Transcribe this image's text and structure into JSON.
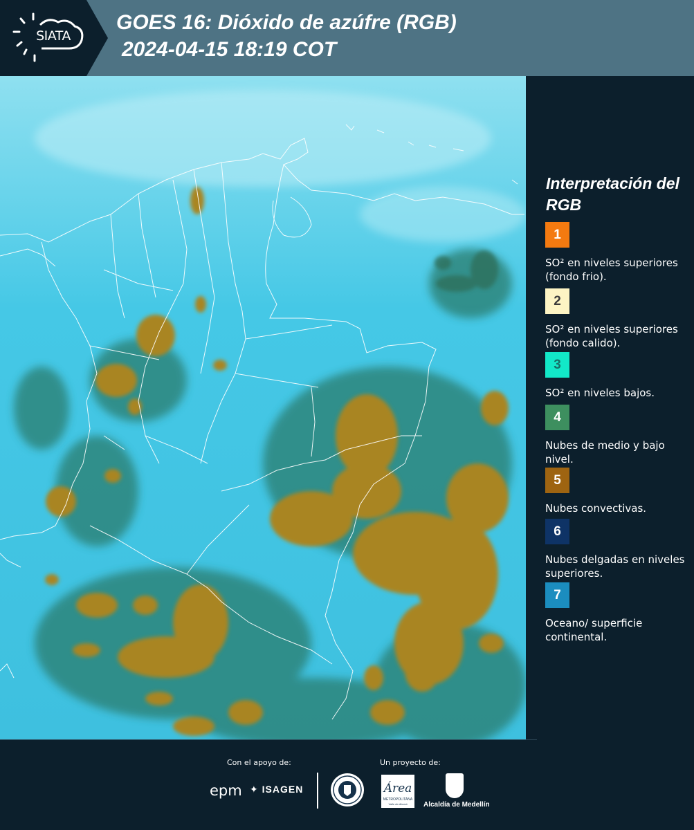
{
  "header": {
    "logo_text": "SIATA",
    "title_line1": "GOES 16: Dióxido de azúfre (RGB)",
    "title_line2": "2024-04-15 18:19 COT"
  },
  "legend": {
    "title": "Interpretación del RGB",
    "items": [
      {
        "number": "1",
        "color": "#f47a10",
        "text": "SO² en niveles superiores (fondo frio)."
      },
      {
        "number": "2",
        "color": "#fdf4c4",
        "text": "SO² en niveles superiores (fondo calido)."
      },
      {
        "number": "3",
        "color": "#12e8c8",
        "text": "SO² en niveles bajos."
      },
      {
        "number": "4",
        "color": "#3d8f5f",
        "text": "Nubes de medio y bajo nivel."
      },
      {
        "number": "5",
        "color": "#9e6411",
        "text": "Nubes convectivas."
      },
      {
        "number": "6",
        "color": "#0e3366",
        "text": "Nubes delgadas en niveles superiores."
      },
      {
        "number": "7",
        "color": "#1b8dbf",
        "text": "Oceano/ superficie continental."
      }
    ]
  },
  "footer": {
    "support_caption": "Con el apoyo de:",
    "project_caption": "Un proyecto de:",
    "sponsors": [
      "epm",
      "ISAGEN"
    ],
    "area_logo_text": "Área",
    "area_logo_sub": "METROPOLITANA",
    "area_logo_sub2": "Valle de Aburrá",
    "medellin_label": "Alcaldía de Medellín"
  },
  "colors": {
    "background": "#0c1f2c",
    "header": "#4e7384",
    "map_base": "#39c3e0",
    "cloud": "#a98520",
    "cloud_edge": "#2e7f77"
  }
}
